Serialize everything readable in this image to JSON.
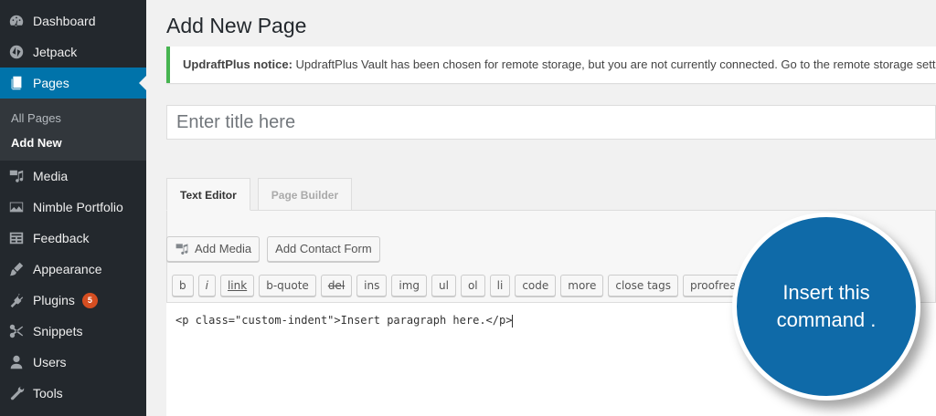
{
  "sidebar": {
    "items": [
      {
        "label": "Dashboard",
        "icon": "dashboard-icon"
      },
      {
        "label": "Jetpack",
        "icon": "jetpack-icon"
      },
      {
        "label": "Pages",
        "icon": "pages-icon",
        "active": true
      },
      {
        "label": "Media",
        "icon": "media-icon"
      },
      {
        "label": "Nimble Portfolio",
        "icon": "portfolio-icon"
      },
      {
        "label": "Feedback",
        "icon": "feedback-icon"
      },
      {
        "label": "Appearance",
        "icon": "appearance-icon"
      },
      {
        "label": "Plugins",
        "icon": "plugins-icon",
        "badge": "5"
      },
      {
        "label": "Snippets",
        "icon": "snippets-icon"
      },
      {
        "label": "Users",
        "icon": "users-icon"
      },
      {
        "label": "Tools",
        "icon": "tools-icon"
      }
    ],
    "submenu": [
      "All Pages",
      "Add New"
    ]
  },
  "main": {
    "title": "Add New Page",
    "notice_strong": "UpdraftPlus notice:",
    "notice_text": " UpdraftPlus Vault has been chosen for remote storage, but you are not currently connected. Go to the remote storage settings",
    "title_placeholder": "Enter title here",
    "tabs": [
      "Text Editor",
      "Page Builder"
    ],
    "add_media": "Add Media",
    "add_contact_form": "Add Contact Form",
    "quicktags": [
      "b",
      "i",
      "link",
      "b-quote",
      "del",
      "ins",
      "img",
      "ul",
      "ol",
      "li",
      "code",
      "more",
      "close tags",
      "proofread"
    ],
    "code": "<p class=\"custom-indent\">Insert paragraph here.</p>"
  },
  "callout": {
    "line1": "Insert this",
    "line2": "command ."
  },
  "colors": {
    "accent": "#0073aa",
    "sidebar": "#23282d",
    "callout": "#0f6aa8",
    "notice_border": "#46b450",
    "badge": "#d54e21"
  }
}
